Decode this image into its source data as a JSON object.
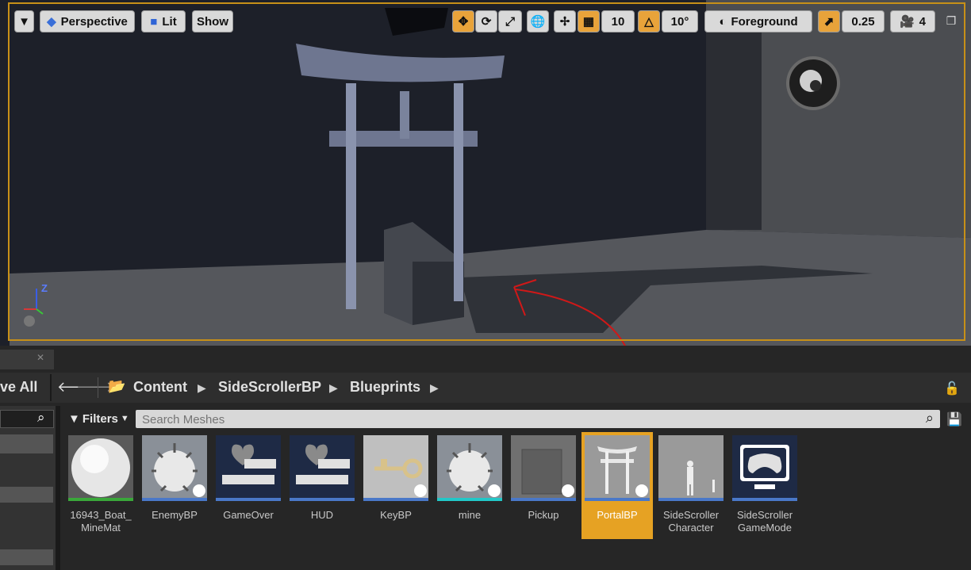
{
  "viewport_toolbar": {
    "perspective_label": "Perspective",
    "lit_label": "Lit",
    "show_label": "Show",
    "grid_snap_value": "10",
    "rotation_snap_value": "10°",
    "layer_label": "Foreground",
    "scale_snap_value": "0.25",
    "camera_speed_value": "4"
  },
  "viewport": {
    "axis_z_label": "Z"
  },
  "content_browser": {
    "save_all_label": "ve All",
    "breadcrumbs": [
      "Content",
      "SideScrollerBP",
      "Blueprints"
    ],
    "filters_label": "Filters",
    "search_placeholder": "Search Meshes",
    "assets": [
      {
        "label": "16943_Boat_\nMineMat",
        "bar_color": "#3aa83a",
        "selected": false,
        "icon": "sphere-material-icon"
      },
      {
        "label": "EnemyBP",
        "bar_color": "#4a78c8",
        "selected": false,
        "icon": "mine-icon"
      },
      {
        "label": "GameOver",
        "bar_color": "#4a78c8",
        "selected": false,
        "icon": "widget-heart-icon"
      },
      {
        "label": "HUD",
        "bar_color": "#4a78c8",
        "selected": false,
        "icon": "widget-heart-icon"
      },
      {
        "label": "KeyBP",
        "bar_color": "#4a78c8",
        "selected": false,
        "icon": "key-icon"
      },
      {
        "label": "mine",
        "bar_color": "#22c8c8",
        "selected": false,
        "icon": "mine-icon"
      },
      {
        "label": "Pickup",
        "bar_color": "#4a78c8",
        "selected": false,
        "icon": "cube-icon"
      },
      {
        "label": "PortalBP",
        "bar_color": "#4a78c8",
        "selected": true,
        "icon": "torii-gate-icon"
      },
      {
        "label": "SideScroller\nCharacter",
        "bar_color": "#4a78c8",
        "selected": false,
        "icon": "mannequin-icon"
      },
      {
        "label": "SideScroller\nGameMode",
        "bar_color": "#4a78c8",
        "selected": false,
        "icon": "gamepad-icon"
      }
    ]
  }
}
